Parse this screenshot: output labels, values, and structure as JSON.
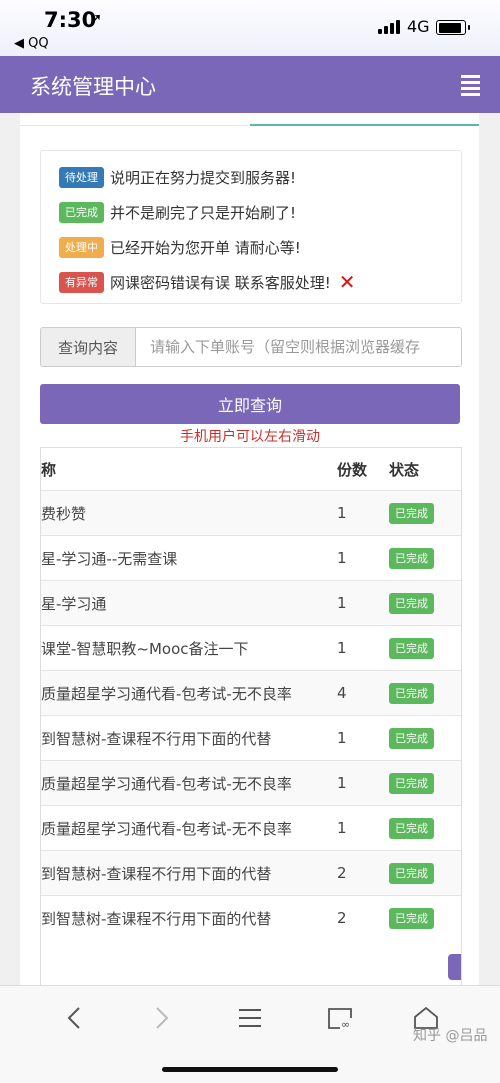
{
  "status_bar": {
    "time": "7:30",
    "back_app": "◀ QQ",
    "network": "4G"
  },
  "header": {
    "title": "系统管理中心"
  },
  "legend": [
    {
      "badge": "待处理",
      "color": "#337ab7",
      "text": "说明正在努力提交到服务器!"
    },
    {
      "badge": "已完成",
      "color": "#5cb85c",
      "text": "并不是刷完了只是开始刷了!"
    },
    {
      "badge": "处理中",
      "color": "#f0ad4e",
      "text": "已经开始为您开单 请耐心等!"
    },
    {
      "badge": "有异常",
      "color": "#d9534f",
      "text": "网课密码错误有误 联系客服处理!"
    }
  ],
  "search": {
    "label": "查询内容",
    "placeholder": "请输入下单账号（留空则根据浏览器缓存",
    "button": "立即查询"
  },
  "hint": "手机用户可以左右滑动",
  "table": {
    "headers": [
      "称",
      "份数",
      "状态"
    ],
    "rows": [
      {
        "name": "费秒赞",
        "qty": "1",
        "status": "已完成"
      },
      {
        "name": "星-学习通--无需查课",
        "qty": "1",
        "status": "已完成"
      },
      {
        "name": "星-学习通",
        "qty": "1",
        "status": "已完成"
      },
      {
        "name": "课堂-智慧职教~Mooc备注一下",
        "qty": "1",
        "status": "已完成"
      },
      {
        "name": "质量超星学习通代看-包考试-无不良率",
        "qty": "4",
        "status": "已完成"
      },
      {
        "name": "到智慧树-查课程不行用下面的代替",
        "qty": "1",
        "status": "已完成"
      },
      {
        "name": "质量超星学习通代看-包考试-无不良率",
        "qty": "1",
        "status": "已完成"
      },
      {
        "name": "质量超星学习通代看-包考试-无不良率",
        "qty": "1",
        "status": "已完成"
      },
      {
        "name": "到智慧树-查课程不行用下面的代替",
        "qty": "2",
        "status": "已完成"
      },
      {
        "name": "到智慧树-查课程不行用下面的代替",
        "qty": "2",
        "status": "已完成"
      }
    ]
  },
  "watermark": "知乎 @吕品"
}
